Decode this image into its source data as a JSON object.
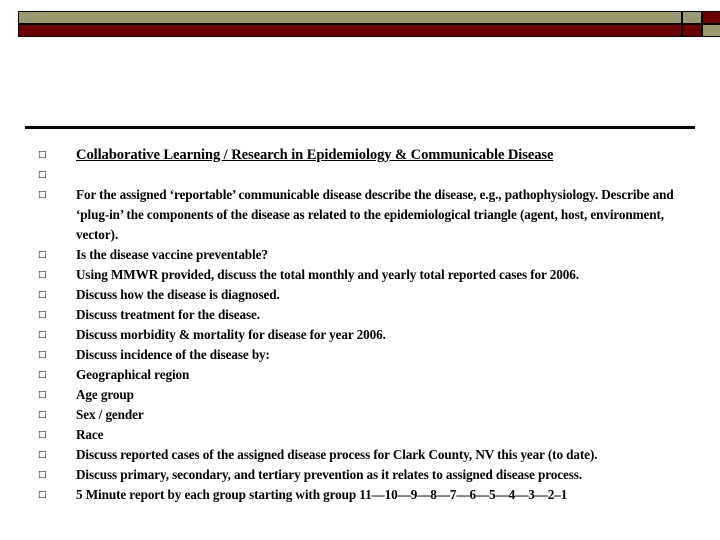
{
  "slide": {
    "banner": {
      "bar_color": "#9a9a6e",
      "accent_color": "#6b0000",
      "outline_color": "#000000"
    },
    "divider_color": "#000000",
    "bullet_glyph": "□",
    "items": [
      {
        "kind": "title",
        "text": "Collaborative Learning / Research in Epidemiology & Communicable Disease"
      },
      {
        "kind": "spacer",
        "text": ""
      },
      {
        "kind": "para",
        "text": "For the assigned ‘reportable’ communicable disease describe the disease, e.g., pathophysiology. Describe and ‘plug-in’ the components of the disease as related to the epidemiological triangle (agent, host, environment, vector)."
      },
      {
        "kind": "item",
        "text": "Is the disease vaccine preventable?"
      },
      {
        "kind": "item",
        "text": "Using  MMWR provided, discuss the total monthly and yearly total reported cases for 2006."
      },
      {
        "kind": "item",
        "text": "Discuss how the disease is diagnosed."
      },
      {
        "kind": "item",
        "text": "Discuss treatment for the disease."
      },
      {
        "kind": "item",
        "text": "Discuss morbidity & mortality for disease for year 2006."
      },
      {
        "kind": "item",
        "text": "Discuss incidence of the disease by:"
      },
      {
        "kind": "item",
        "text": "Geographical region"
      },
      {
        "kind": "item",
        "text": "Age group"
      },
      {
        "kind": "item",
        "text": "Sex / gender"
      },
      {
        "kind": "item",
        "text": "Race"
      },
      {
        "kind": "item",
        "text": "Discuss reported cases of the assigned disease process for Clark County, NV this year (to date)."
      },
      {
        "kind": "item",
        "text": "Discuss primary, secondary, and tertiary prevention as it relates to assigned disease process."
      },
      {
        "kind": "item",
        "text": "5 Minute report by each group starting with group 11—10—9—8—7—6—5—4—3—2–1"
      }
    ]
  }
}
